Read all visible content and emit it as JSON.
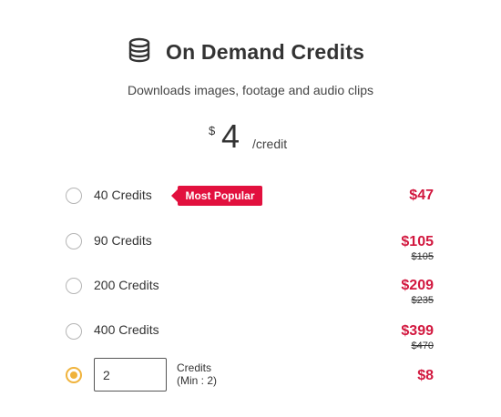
{
  "header": {
    "icon": "database-icon",
    "title": "On Demand Credits",
    "subtitle": "Downloads images, footage and audio clips"
  },
  "pricing": {
    "currency": "$",
    "amount": "4",
    "unit": "/credit"
  },
  "options": [
    {
      "label": "40 Credits",
      "price": "$47",
      "old_price": "",
      "badge": "Most Popular",
      "selected": false
    },
    {
      "label": "90 Credits",
      "price": "$105",
      "old_price": "$105",
      "selected": false
    },
    {
      "label": "200 Credits",
      "price": "$209",
      "old_price": "$235",
      "selected": false
    },
    {
      "label": "400 Credits",
      "price": "$399",
      "old_price": "$470",
      "selected": false
    }
  ],
  "custom": {
    "value": "2",
    "label_line1": "Credits",
    "label_line2": "(Min : 2)",
    "price": "$8",
    "selected": true
  },
  "colors": {
    "accent": "#e2103e",
    "price": "#d2183f",
    "radio_selected": "#f0b33c"
  }
}
